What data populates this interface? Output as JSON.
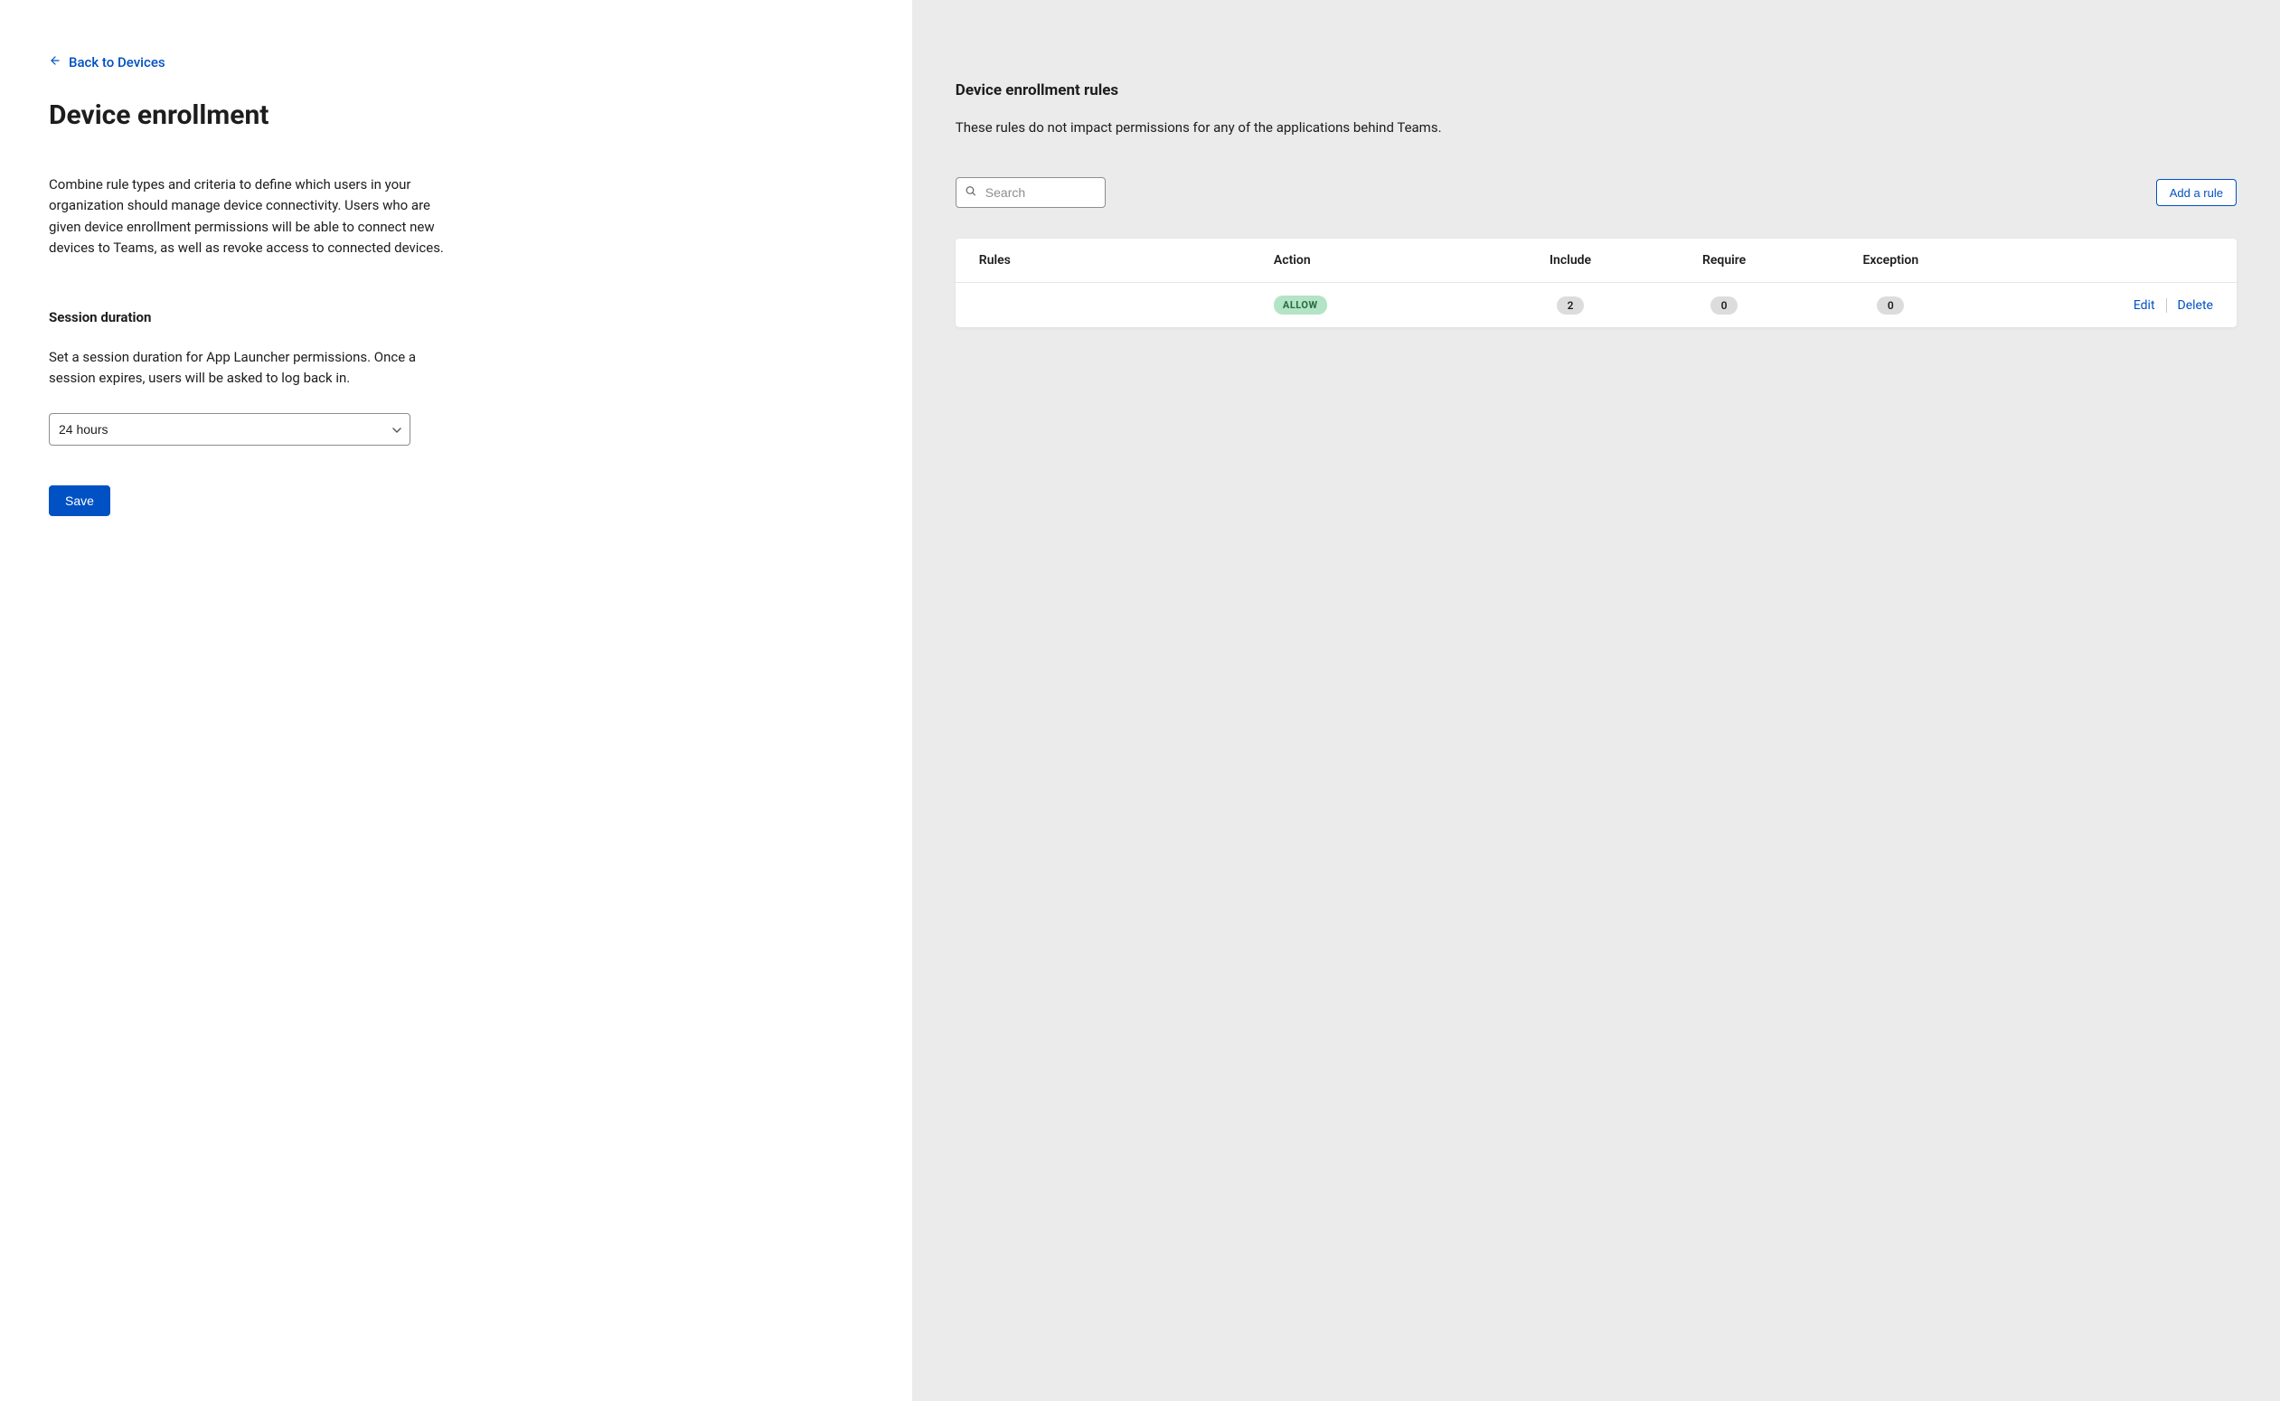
{
  "left": {
    "back_label": "Back to Devices",
    "title": "Device enrollment",
    "description": "Combine rule types and criteria to define which users in your organization should manage device connectivity. Users who are given device enrollment permissions will be able to connect new devices to Teams, as well as revoke access to connected devices.",
    "session": {
      "heading": "Session duration",
      "description": "Set a session duration for App Launcher permissions. Once a session expires, users will be asked to log back in.",
      "selected": "24 hours"
    },
    "save_label": "Save"
  },
  "right": {
    "title": "Device enrollment rules",
    "description": "These rules do not impact permissions for any of the applications behind Teams.",
    "search_placeholder": "Search",
    "add_rule_label": "Add a rule",
    "columns": {
      "rules": "Rules",
      "action": "Action",
      "include": "Include",
      "require": "Require",
      "exception": "Exception"
    },
    "rows": [
      {
        "name": "",
        "action_badge": "ALLOW",
        "include": "2",
        "require": "0",
        "exception": "0",
        "edit_label": "Edit",
        "delete_label": "Delete"
      }
    ]
  }
}
